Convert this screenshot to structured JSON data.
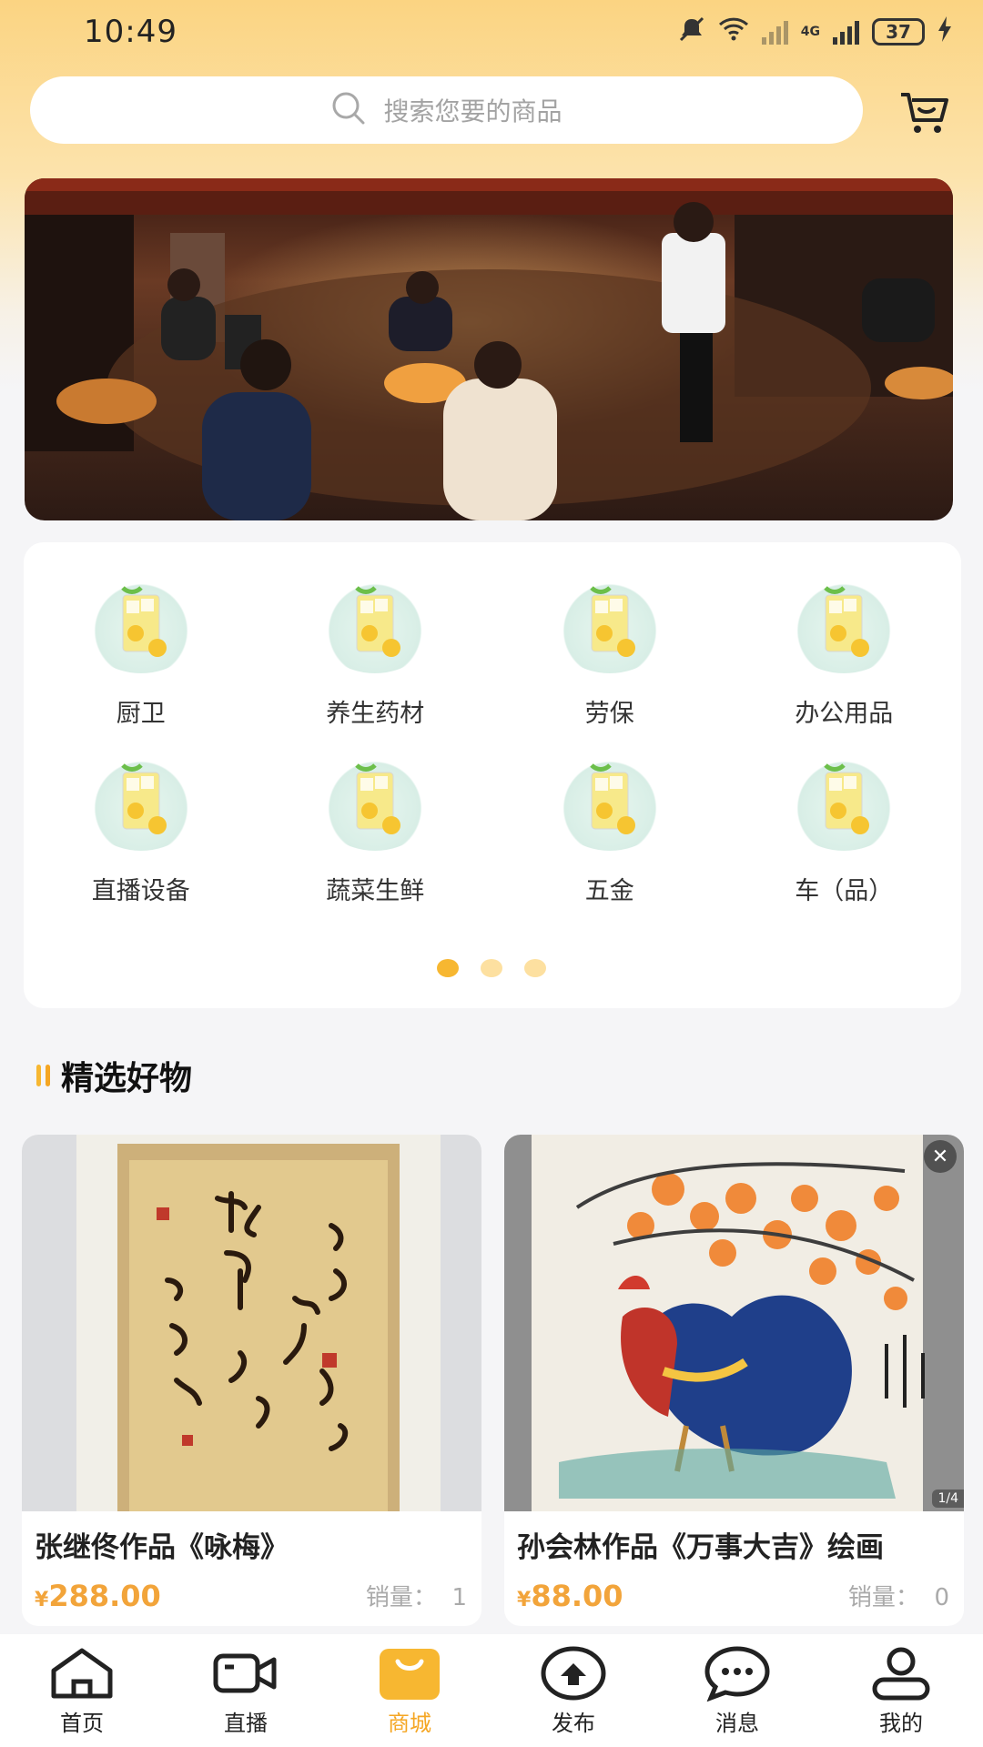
{
  "status_bar": {
    "time": "10:49",
    "network": "4G",
    "battery": "37"
  },
  "search": {
    "placeholder": "搜索您要的商品"
  },
  "categories": {
    "items": [
      {
        "label": "厨卫"
      },
      {
        "label": "养生药材"
      },
      {
        "label": "劳保"
      },
      {
        "label": "办公用品"
      },
      {
        "label": "直播设备"
      },
      {
        "label": "蔬菜生鲜"
      },
      {
        "label": "五金"
      },
      {
        "label": "车（品）"
      }
    ],
    "pages": 3,
    "active_page": 1
  },
  "section": {
    "title": "精选好物"
  },
  "products": [
    {
      "title": "张继佟作品《咏梅》",
      "currency": "¥",
      "price": "288.00",
      "sales_label": "销量：",
      "sales": "1"
    },
    {
      "title": "孙会林作品《万事大吉》绘画",
      "currency": "¥",
      "price": "88.00",
      "sales_label": "销量：",
      "sales": "0",
      "image_counter": "1/4"
    }
  ],
  "tabs": [
    {
      "label": "首页",
      "icon": "home-icon"
    },
    {
      "label": "直播",
      "icon": "video-icon"
    },
    {
      "label": "商城",
      "icon": "shopping-bag-icon",
      "active": true
    },
    {
      "label": "发布",
      "icon": "upload-icon"
    },
    {
      "label": "消息",
      "icon": "message-icon"
    },
    {
      "label": "我的",
      "icon": "user-icon"
    }
  ],
  "colors": {
    "accent": "#f5a623",
    "price": "#f2a43a",
    "top_gradient": "#fbd482"
  }
}
